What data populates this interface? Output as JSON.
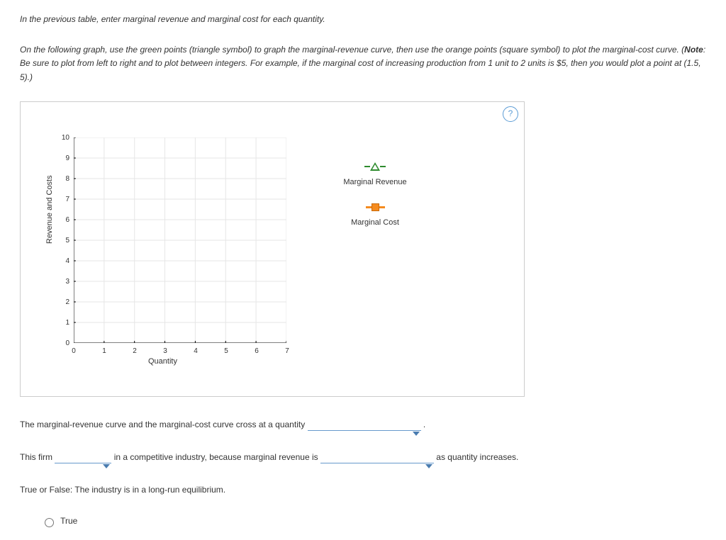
{
  "intro_instruction": "In the previous table, enter marginal revenue and marginal cost for each quantity.",
  "graph_instruction_prefix": "On the following graph, use the green points (triangle symbol) to graph the marginal-revenue curve, then use the orange points (square symbol) to plot the marginal-cost curve. (",
  "graph_instruction_note_label": "Note",
  "graph_instruction_suffix": ": Be sure to plot from left to right and to plot between integers. For example, if the marginal cost of increasing production from 1 unit to 2 units is $5, then you would plot a point at (1.5, 5).)",
  "help_symbol": "?",
  "chart_data": {
    "type": "scatter",
    "title": "",
    "xlabel": "Quantity",
    "ylabel": "Revenue and Costs",
    "xlim": [
      0,
      7
    ],
    "ylim": [
      0,
      10
    ],
    "x_ticks": [
      0,
      1,
      2,
      3,
      4,
      5,
      6,
      7
    ],
    "y_ticks": [
      0,
      1,
      2,
      3,
      4,
      5,
      6,
      7,
      8,
      9,
      10
    ],
    "series": [
      {
        "name": "Marginal Revenue",
        "symbol": "triangle",
        "color": "#2e8b2e",
        "x": [],
        "y": []
      },
      {
        "name": "Marginal Cost",
        "symbol": "square",
        "color": "#f58b1f",
        "x": [],
        "y": []
      }
    ]
  },
  "q1_prefix": "The marginal-revenue curve and the marginal-cost curve cross at a quantity ",
  "q1_suffix": " .",
  "q2_prefix": "This firm ",
  "q2_mid": " in a competitive industry, because marginal revenue is ",
  "q2_suffix": " as quantity increases.",
  "q3_text": "True or False: The industry is in a long-run equilibrium.",
  "radio_true_label": "True"
}
